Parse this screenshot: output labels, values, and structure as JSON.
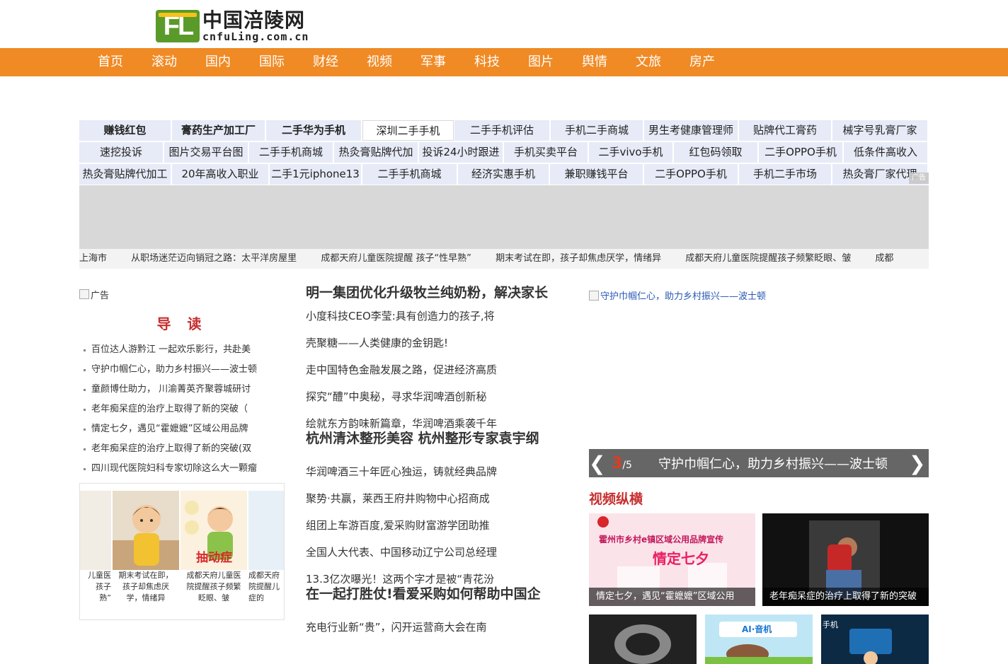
{
  "logo": {
    "mark": "FL",
    "name_cn": "中国涪陵网",
    "domain": "cnfuLing.com.cn"
  },
  "nav": [
    "首页",
    "滚动",
    "国内",
    "国际",
    "财经",
    "视频",
    "军事",
    "科技",
    "图片",
    "舆情",
    "文旅",
    "房产"
  ],
  "tags": {
    "row1": [
      "赚钱红包",
      "膏药生产加工厂",
      "二手华为手机",
      "深圳二手手机",
      "二手手机评估",
      "手机二手商城",
      "男生考健康管理师",
      "贴牌代工膏药",
      "械字号乳膏厂家"
    ],
    "row2": [
      "速挖投诉",
      "图片交易平台图",
      "二手手机商城",
      "热灸膏贴牌代加",
      "投诉24小时跟进",
      "手机买卖平台",
      "二手vivo手机",
      "红包码领取",
      "二手OPPO手机",
      "低条件高收入"
    ],
    "row3": [
      "热灸膏贴牌代加工",
      "20年高收入职业",
      "二手1元iphone13",
      "二手手机商城",
      "经济实惠手机",
      "兼职赚钱平台",
      "二手OPPO手机",
      "手机二手市场",
      "热灸膏厂家代理"
    ]
  },
  "ad_badge": "广告",
  "ticker": [
    "上海市",
    "从职场迷茫迈向销冠之路：太平洋房屋里",
    "成都天府儿童医院提醒 孩子“性早熟”",
    "期末考试在即，孩子却焦虑厌学，情绪异",
    "成都天府儿童医院提醒孩子频繁眨眼、皱",
    "成都"
  ],
  "left": {
    "ad_alt": "广告",
    "heading": "导 读",
    "guide": [
      "百位达人游黔江 一起欢乐影行，共赴美",
      "守护巾帼仁心，助力乡村振兴——波士顿",
      "童颜博仕助力， 川渝菁英齐聚蓉城研讨",
      "老年痴呆症的治疗上取得了新的突破（",
      "情定七夕，遇见“霍嬷嬷”区域公用品牌",
      "老年痴呆症的治疗上取得了新的突破(双",
      "四川现代医院妇科专家切除这么大一颗瘤"
    ],
    "thumbs": [
      {
        "caption": "儿童医\n孩子\n熟”"
      },
      {
        "caption": "期末考试在即，\n孩子却焦虑厌\n学，情绪异"
      },
      {
        "caption": "成都天府儿童医\n院提醒孩子频繁\n眨眼、皱",
        "badge": "抽动症"
      },
      {
        "caption": "成都天府\n院提醒儿\n症的"
      }
    ]
  },
  "middle": {
    "headline1": "明一集团优化升级牧兰纯奶粉，解决家长",
    "group1": [
      "小度科技CEO李莹:具有创造力的孩子,将",
      "壳聚糖——人类健康的金钥匙!",
      "走中国特色金融发展之路，促进经济高质",
      "探究“醴”中奥秘，寻求华润啤酒创新秘",
      "绘就东方韵味新篇章，华润啤酒乘袭千年"
    ],
    "headline2": "杭州清沐整形美容 杭州整形专家袁宇纲",
    "group2": [
      "华润啤酒三十年匠心独运，铸就经典品牌",
      "聚势·共赢，莱西王府井购物中心招商成",
      "组团上车游百度,爱采购财富游学团助推",
      "全国人大代表、中国移动辽宁公司总经理",
      "13.3亿次曝光！这两个字才是被“青花汾"
    ],
    "headline3": "在一起打胜仗!看爱采购如何帮助中国企",
    "group3": [
      "充电行业新“贵”，闪开运营商大会在南"
    ]
  },
  "right": {
    "slide_alt": "守护巾帼仁心，助力乡村振兴——波士顿",
    "slide_current": "3",
    "slide_total": "/5",
    "slide_title": "守护巾帼仁心，助力乡村振兴——波士顿",
    "prev": "❮",
    "next": "❯",
    "video_heading": "视频纵横",
    "videos": [
      {
        "caption": "情定七夕，遇见“霍嬷嬷”区域公用",
        "banner": "霍州市乡村e镇区域公用品牌宣传",
        "script": "情定七夕"
      },
      {
        "caption": "老年痴呆症的治疗上取得了新的突破"
      }
    ],
    "mini_labels": [
      "AI·音机",
      "手机"
    ]
  }
}
